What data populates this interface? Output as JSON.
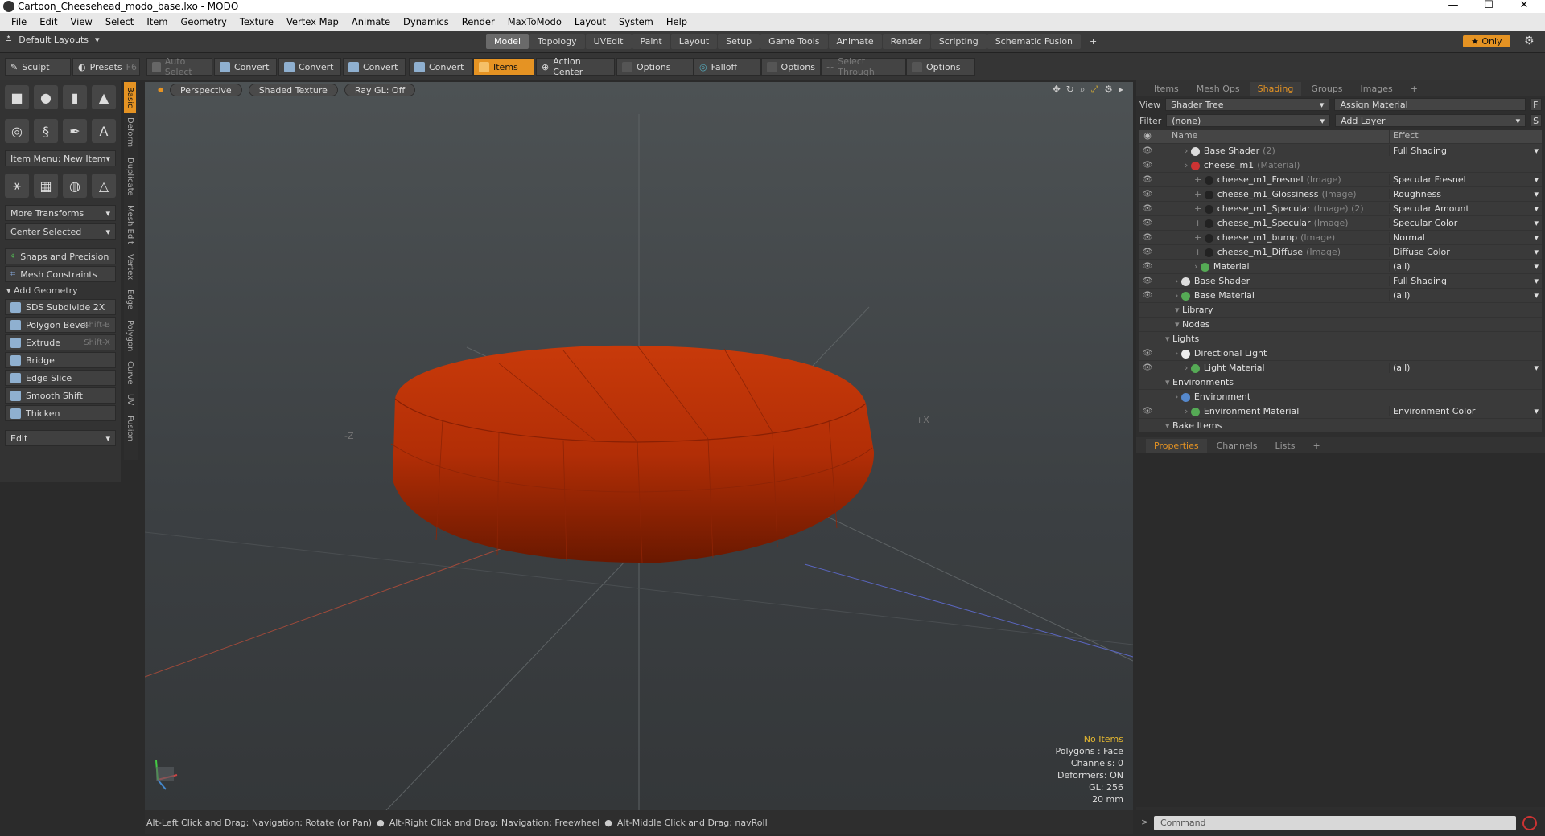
{
  "title": "Cartoon_Cheesehead_modo_base.lxo - MODO",
  "menu": [
    "File",
    "Edit",
    "View",
    "Select",
    "Item",
    "Geometry",
    "Texture",
    "Vertex Map",
    "Animate",
    "Dynamics",
    "Render",
    "MaxToModo",
    "Layout",
    "System",
    "Help"
  ],
  "layout": {
    "default": "Default Layouts",
    "tabs": [
      "Model",
      "Topology",
      "UVEdit",
      "Paint",
      "Layout",
      "Setup",
      "Game Tools",
      "Animate",
      "Render",
      "Scripting",
      "Schematic Fusion"
    ],
    "add": "+",
    "only": "Only"
  },
  "toolbar": {
    "sculpt": "Sculpt",
    "presets": "Presets",
    "presets_key": "F6",
    "auto_select": "Auto Select",
    "convert": "Convert",
    "items": "Items",
    "action_center": "Action Center",
    "options": "Options",
    "falloff": "Falloff",
    "select_through": "Select Through"
  },
  "left": {
    "item_menu": "Item Menu: New Item",
    "more_transforms": "More Transforms",
    "center_selected": "Center Selected",
    "snaps": "Snaps and Precision",
    "constraints": "Mesh Constraints",
    "add_geometry": "Add Geometry",
    "tools": [
      {
        "label": "SDS Subdivide 2X",
        "key": ""
      },
      {
        "label": "Polygon Bevel",
        "key": "Shift-B"
      },
      {
        "label": "Extrude",
        "key": "Shift-X"
      },
      {
        "label": "Bridge",
        "key": ""
      },
      {
        "label": "Edge Slice",
        "key": ""
      },
      {
        "label": "Smooth Shift",
        "key": ""
      },
      {
        "label": "Thicken",
        "key": ""
      }
    ],
    "edit": "Edit"
  },
  "vtabs": [
    "Basic",
    "Deform",
    "Duplicate",
    "Mesh Edit",
    "Vertex",
    "Edge",
    "Polygon",
    "Curve",
    "UV",
    "Fusion"
  ],
  "viewport": {
    "perspective": "Perspective",
    "shaded": "Shaded Texture",
    "raygl": "Ray GL: Off",
    "axis_neg": "-Z",
    "axis_pos": "+X",
    "stats": [
      "No Items",
      "Polygons : Face",
      "Channels: 0",
      "Deformers: ON",
      "GL: 256",
      "20 mm"
    ]
  },
  "status": [
    "Alt-Left Click and Drag: Navigation: Rotate (or Pan)",
    "Alt-Right Click and Drag: Navigation: Freewheel",
    "Alt-Middle Click and Drag: navRoll"
  ],
  "right": {
    "tabs": [
      "Items",
      "Mesh Ops",
      "Shading",
      "Groups",
      "Images",
      "+"
    ],
    "view_label": "View",
    "view": "Shader Tree",
    "assign": "Assign Material",
    "filter_label": "Filter",
    "filter": "(none)",
    "add_layer": "Add Layer",
    "col_name": "Name",
    "col_effect": "Effect",
    "rows": [
      {
        "indent": 3,
        "name": "Base Shader",
        "sub": "(2)",
        "effect": "Full Shading",
        "ball": "#ddd",
        "eye": true
      },
      {
        "indent": 3,
        "name": "cheese_m1",
        "sub": "(Material)",
        "effect": "",
        "ball": "#c33",
        "eye": true
      },
      {
        "indent": 4,
        "name": "cheese_m1_Fresnel",
        "sub": "(Image)",
        "effect": "Specular Fresnel",
        "ball": "#222",
        "eye": true
      },
      {
        "indent": 4,
        "name": "cheese_m1_Glossiness",
        "sub": "(Image)",
        "effect": "Roughness",
        "ball": "#222",
        "eye": true
      },
      {
        "indent": 4,
        "name": "cheese_m1_Specular",
        "sub": "(Image) (2)",
        "effect": "Specular Amount",
        "ball": "#222",
        "eye": true
      },
      {
        "indent": 4,
        "name": "cheese_m1_Specular",
        "sub": "(Image)",
        "effect": "Specular Color",
        "ball": "#222",
        "eye": true
      },
      {
        "indent": 4,
        "name": "cheese_m1_bump",
        "sub": "(Image)",
        "effect": "Normal",
        "ball": "#222",
        "eye": true
      },
      {
        "indent": 4,
        "name": "cheese_m1_Diffuse",
        "sub": "(Image)",
        "effect": "Diffuse Color",
        "ball": "#222",
        "eye": true
      },
      {
        "indent": 4,
        "name": "Material",
        "sub": "",
        "effect": "(all)",
        "ball": "#5a5",
        "eye": true
      },
      {
        "indent": 2,
        "name": "Base Shader",
        "sub": "",
        "effect": "Full Shading",
        "ball": "#ddd",
        "eye": true
      },
      {
        "indent": 2,
        "name": "Base Material",
        "sub": "",
        "effect": "(all)",
        "ball": "#5a5",
        "eye": true
      },
      {
        "indent": 2,
        "name": "Library",
        "sub": "",
        "effect": "",
        "ball": "",
        "eye": false
      },
      {
        "indent": 2,
        "name": "Nodes",
        "sub": "",
        "effect": "",
        "ball": "",
        "eye": false
      },
      {
        "indent": 1,
        "name": "Lights",
        "sub": "",
        "effect": "",
        "ball": "",
        "eye": false
      },
      {
        "indent": 2,
        "name": "Directional Light",
        "sub": "",
        "effect": "",
        "ball": "#eee",
        "eye": true
      },
      {
        "indent": 3,
        "name": "Light Material",
        "sub": "",
        "effect": "(all)",
        "ball": "#5a5",
        "eye": true
      },
      {
        "indent": 1,
        "name": "Environments",
        "sub": "",
        "effect": "",
        "ball": "",
        "eye": false
      },
      {
        "indent": 2,
        "name": "Environment",
        "sub": "",
        "effect": "",
        "ball": "#58c",
        "eye": false
      },
      {
        "indent": 3,
        "name": "Environment Material",
        "sub": "",
        "effect": "Environment Color",
        "ball": "#5a5",
        "eye": true
      },
      {
        "indent": 1,
        "name": "Bake Items",
        "sub": "",
        "effect": "",
        "ball": "",
        "eye": false
      }
    ],
    "lower_tabs": [
      "Properties",
      "Channels",
      "Lists",
      "+"
    ]
  },
  "command": "Command"
}
